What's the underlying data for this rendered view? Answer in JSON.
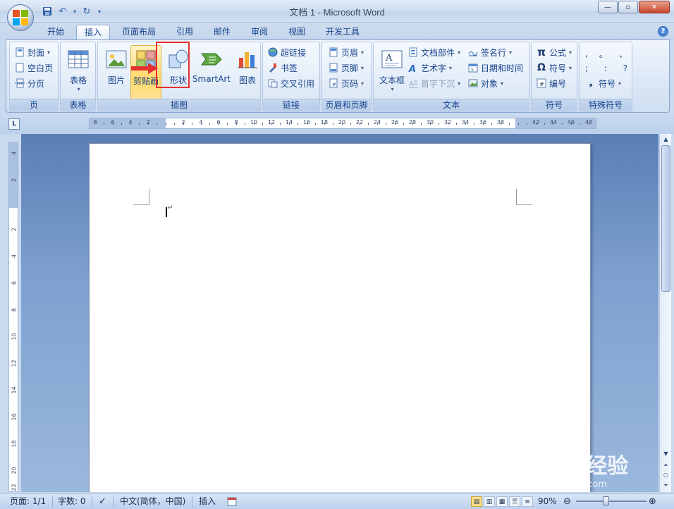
{
  "window": {
    "title": "文档 1 - Microsoft Word",
    "minimize": "—",
    "maximize": "▫",
    "close": "✕"
  },
  "tabs": [
    {
      "label": "开始"
    },
    {
      "label": "插入"
    },
    {
      "label": "页面布局"
    },
    {
      "label": "引用"
    },
    {
      "label": "邮件"
    },
    {
      "label": "审阅"
    },
    {
      "label": "视图"
    },
    {
      "label": "开发工具"
    }
  ],
  "ribbon": {
    "pages": {
      "label": "页",
      "items": [
        "封面",
        "空白页",
        "分页"
      ]
    },
    "tables": {
      "label": "表格",
      "items": [
        "表格"
      ]
    },
    "illustrations": {
      "label": "插图",
      "items": [
        "图片",
        "剪贴画",
        "形状",
        "SmartArt",
        "图表"
      ]
    },
    "links": {
      "label": "链接",
      "items": [
        "超链接",
        "书签",
        "交叉引用"
      ]
    },
    "header_footer": {
      "label": "页眉和页脚",
      "items": [
        "页眉",
        "页脚",
        "页码"
      ]
    },
    "text": {
      "label": "文本",
      "textbox": "文本框",
      "items": [
        "文档部件",
        "艺术字",
        "首字下沉",
        "签名行",
        "日期和时间",
        "对象"
      ]
    },
    "symbols": {
      "label": "符号",
      "items": [
        "公式",
        "符号",
        "编号"
      ]
    },
    "special": {
      "label": "特殊符号",
      "chars": [
        ",",
        "。",
        "、",
        ";",
        ":",
        "?"
      ],
      "more": "符号"
    }
  },
  "ruler": {
    "corner": "L",
    "numbers": [
      "8",
      "6",
      "4",
      "2",
      "2",
      "4",
      "6",
      "8",
      "10",
      "12",
      "14",
      "16",
      "18",
      "20",
      "22",
      "24",
      "26",
      "28",
      "30",
      "32",
      "34",
      "36",
      "38",
      "42",
      "44",
      "46",
      "48"
    ],
    "vnumbers": [
      "4",
      "2",
      "2",
      "4",
      "6",
      "8",
      "10",
      "12",
      "14",
      "16",
      "18",
      "20",
      "22"
    ]
  },
  "status": {
    "page": "页面: 1/1",
    "words": "字数: 0",
    "language": "中文(简体，中国)",
    "mode": "插入",
    "zoom": "90%",
    "zoom_level_percent": 90
  },
  "watermark": {
    "main": "Baidu经验",
    "sub": "jingyan.baidu.com"
  },
  "colors": {
    "ribbon_text": "#15428b",
    "highlight_box": "#e53030",
    "doc_background": "#7da0cf"
  }
}
